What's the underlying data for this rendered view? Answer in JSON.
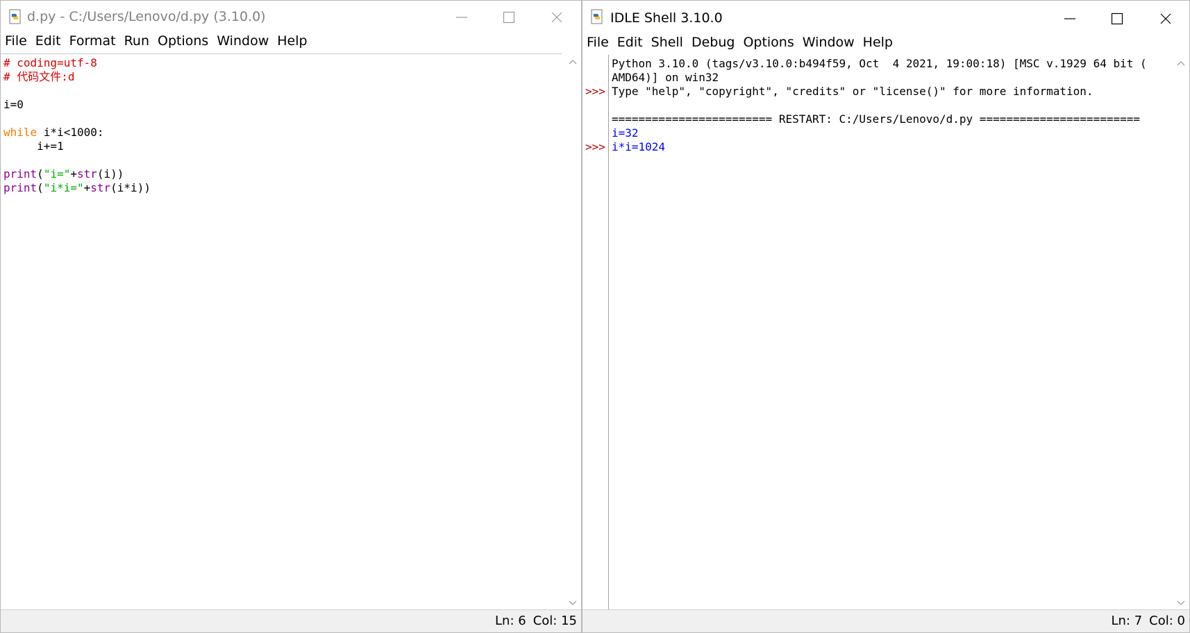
{
  "editor": {
    "title": "d.py - C:/Users/Lenovo/d.py (3.10.0)",
    "menu": [
      "File",
      "Edit",
      "Format",
      "Run",
      "Options",
      "Window",
      "Help"
    ],
    "status": {
      "ln": "Ln: 6",
      "col": "Col: 15"
    },
    "code": {
      "l1": "# coding=utf-8",
      "l2": "# 代码文件:d",
      "l4": "i=0",
      "l6_kw": "while",
      "l6_rest": " i*i<1000:",
      "l7": "     i+=1",
      "l9_fn": "print",
      "l9_p1": "(",
      "l9_str": "\"i=\"",
      "l9_plus": "+",
      "l9_fn2": "str",
      "l9_tail": "(i))",
      "l10_fn": "print",
      "l10_p1": "(",
      "l10_str": "\"i*i=\"",
      "l10_plus": "+",
      "l10_fn2": "str",
      "l10_tail": "(i*i))"
    }
  },
  "shell": {
    "title": "IDLE Shell 3.10.0",
    "menu": [
      "File",
      "Edit",
      "Shell",
      "Debug",
      "Options",
      "Window",
      "Help"
    ],
    "status": {
      "ln": "Ln: 7",
      "col": "Col: 0"
    },
    "prompt": ">>>",
    "lines": {
      "banner1": "Python 3.10.0 (tags/v3.10.0:b494f59, Oct  4 2021, 19:00:18) [MSC v.1929 64 bit (",
      "banner2": "AMD64)] on win32",
      "banner3": "Type \"help\", \"copyright\", \"credits\" or \"license()\" for more information.",
      "restart": "======================== RESTART: C:/Users/Lenovo/d.py ========================",
      "out1": "i=32",
      "out2": "i*i=1024"
    }
  }
}
